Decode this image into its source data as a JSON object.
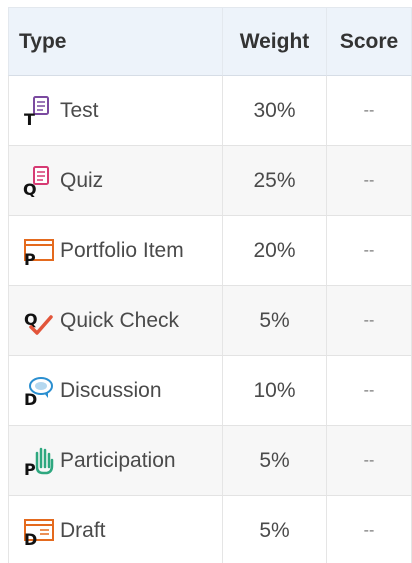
{
  "table": {
    "headers": {
      "type": "Type",
      "weight": "Weight",
      "score": "Score"
    },
    "rows": [
      {
        "icon": "test-icon",
        "type": "Test",
        "weight": "30%",
        "score": "--"
      },
      {
        "icon": "quiz-icon",
        "type": "Quiz",
        "weight": "25%",
        "score": "--"
      },
      {
        "icon": "portfolio-item-icon",
        "type": "Portfolio Item",
        "weight": "20%",
        "score": "--"
      },
      {
        "icon": "quick-check-icon",
        "type": "Quick Check",
        "weight": "5%",
        "score": "--"
      },
      {
        "icon": "discussion-icon",
        "type": "Discussion",
        "weight": "10%",
        "score": "--"
      },
      {
        "icon": "participation-icon",
        "type": "Participation",
        "weight": "5%",
        "score": "--"
      },
      {
        "icon": "draft-icon",
        "type": "Draft",
        "weight": "5%",
        "score": "--"
      }
    ]
  },
  "colors": {
    "header_bg": "#edf3fa",
    "alt_row_bg": "#f7f7f7",
    "test": "#7b4aa0",
    "quiz": "#d63a73",
    "portfolio": "#e46a1e",
    "quick_check": "#e2553a",
    "discussion": "#2b8fd0",
    "participation": "#2ea77f",
    "draft": "#e46a1e"
  }
}
